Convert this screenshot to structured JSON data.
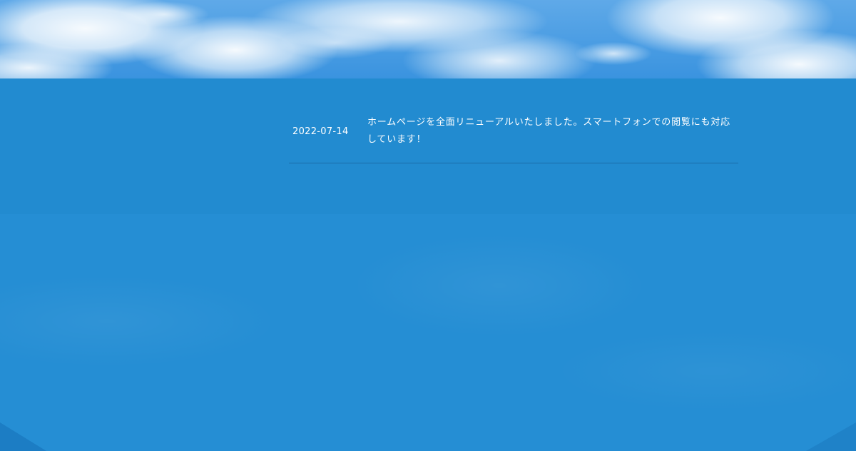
{
  "hero": {
    "image": "sky-clouds"
  },
  "news": {
    "items": [
      {
        "date": "2022-07-14",
        "text": "ホームページを全面リニューアルいたしました。スマートフォンでの閲覧にも対応しています！"
      }
    ]
  },
  "colors": {
    "band": "#228bd0",
    "background": "#258ed4",
    "text": "#ffffff"
  }
}
